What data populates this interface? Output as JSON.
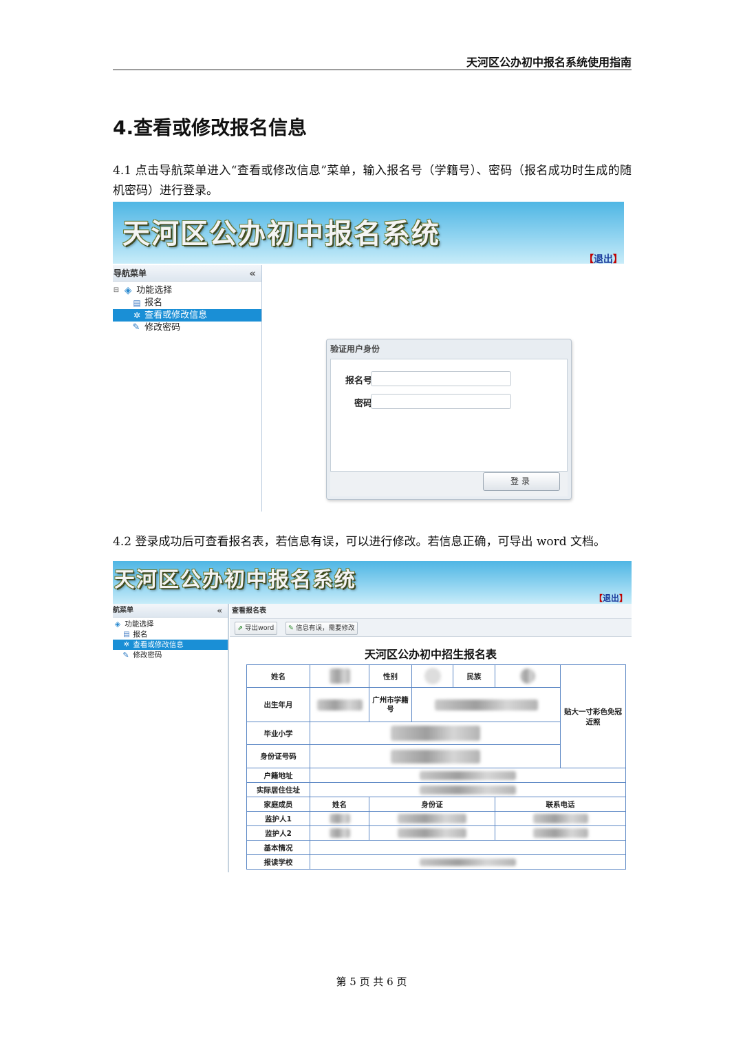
{
  "header": {
    "doc_title": "天河区公办初中报名系统使用指南"
  },
  "section": {
    "title": "4.查看或修改报名信息",
    "p1": "4.1 点击导航菜单进入“查看或修改信息”菜单，输入报名号（学籍号）、密码（报名成功时生成的随机密码）进行登录。",
    "p2": "4.2 登录成功后可查看报名表，若信息有误，可以进行修改。若信息正确，可导出 word 文档。"
  },
  "shot1": {
    "system_title": "天河区公办初中报名系统",
    "logout": "退出",
    "nav_title": "导航菜单",
    "collapse": "«",
    "tree": {
      "root": "功能选择",
      "items": [
        "报名",
        "查看或修改信息",
        "修改密码"
      ],
      "selected_index": 1
    },
    "login": {
      "title": "验证用户身份",
      "reg_no_label": "报名号",
      "password_label": "密码",
      "reg_no_value": "",
      "password_value": "",
      "submit": "登录"
    }
  },
  "shot2": {
    "system_title": "天河区公办初中报名系统",
    "logout": "退出",
    "nav_title": "航菜单",
    "collapse": "«",
    "tree": {
      "root": "功能选择",
      "items": [
        "报名",
        "查看或修改信息",
        "修改密码"
      ],
      "selected_index": 1
    },
    "panel_title": "查看报名表",
    "toolbar": {
      "export": "导出word",
      "edit": "信息有误，需要修改"
    },
    "form_title": "天河区公办初中招生报名表",
    "table": {
      "name": "姓名",
      "gender": "性别",
      "ethnicity": "民族",
      "birth": "出生年月",
      "student_no": "广州市学籍号",
      "photo": "贴大一寸彩色免冠近照",
      "primary_school": "毕业小学",
      "id_no": "身份证号码",
      "hukou": "户籍地址",
      "residence": "实际居住住址",
      "family": "家庭成员",
      "col_name": "姓名",
      "col_id": "身份证",
      "col_phone": "联系电话",
      "guardian1": "监护人1",
      "guardian2": "监护人2",
      "basic": "基本情况",
      "school": "报读学校"
    }
  },
  "footer": {
    "page": "第 5 页 共 6 页"
  }
}
